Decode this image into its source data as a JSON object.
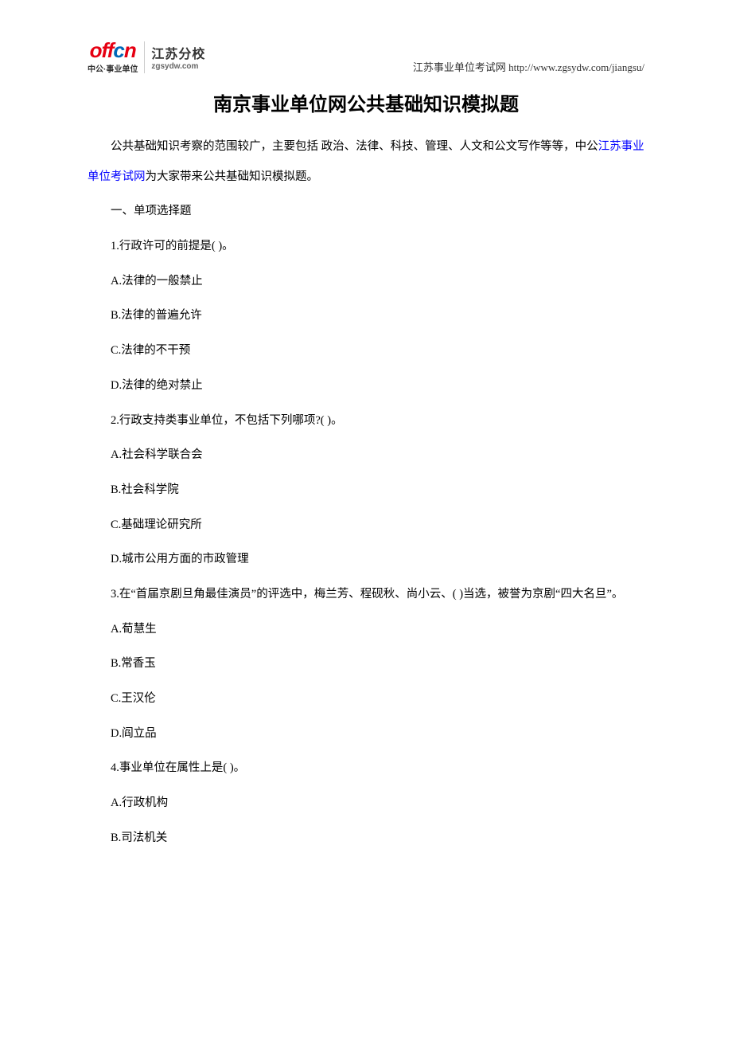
{
  "header": {
    "logo_main": "offcn",
    "logo_sub": "中公·事业单位",
    "logo_right_main": "江苏分校",
    "logo_right_sub": "zgsydw.com",
    "url_text": "江苏事业单位考试网 http://www.zgsydw.com/jiangsu/"
  },
  "title": "南京事业单位网公共基础知识模拟题",
  "intro": {
    "part1": "公共基础知识考察的范围较广，主要包括 政治、法律、科技、管理、人文和公文写作等等，中公",
    "link": "江苏事业单位考试网",
    "part2": "为大家带来公共基础知识模拟题。"
  },
  "section_heading": "一、单项选择题",
  "questions": [
    {
      "text": "1.行政许可的前提是( )。",
      "options": [
        "A.法律的一般禁止",
        "B.法律的普遍允许",
        "C.法律的不干预",
        "D.法律的绝对禁止"
      ]
    },
    {
      "text": "2.行政支持类事业单位，不包括下列哪项?( )。",
      "options": [
        "A.社会科学联合会",
        "B.社会科学院",
        "C.基础理论研究所",
        "D.城市公用方面的市政管理"
      ]
    },
    {
      "text": "3.在“首届京剧旦角最佳演员”的评选中，梅兰芳、程砚秋、尚小云、( )当选，被誉为京剧“四大名旦”。",
      "options": [
        "A.荀慧生",
        "B.常香玉",
        "C.王汉伦",
        "D.阎立品"
      ]
    },
    {
      "text": "4.事业单位在属性上是( )。",
      "options": [
        "A.行政机构",
        "B.司法机关"
      ]
    }
  ]
}
